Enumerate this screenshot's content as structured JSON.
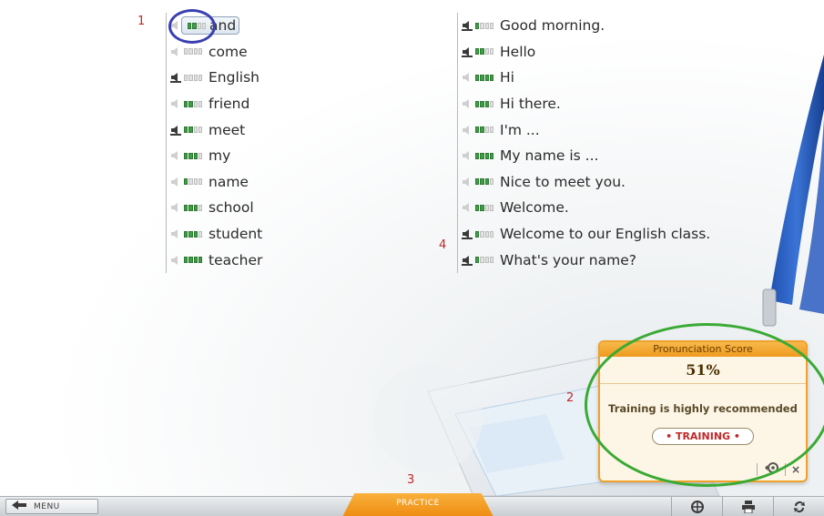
{
  "words": [
    {
      "text": "and",
      "icon": "speaker-icon",
      "recorded": false,
      "level": 2,
      "selected": true
    },
    {
      "text": "come",
      "icon": "speaker-icon",
      "recorded": false,
      "level": 0,
      "selected": false
    },
    {
      "text": "English",
      "icon": "speaker-icon",
      "recorded": true,
      "level": 0,
      "selected": false
    },
    {
      "text": "friend",
      "icon": "speaker-icon",
      "recorded": false,
      "level": 2,
      "selected": false
    },
    {
      "text": "meet",
      "icon": "speaker-icon",
      "recorded": true,
      "level": 2,
      "selected": false
    },
    {
      "text": "my",
      "icon": "speaker-icon",
      "recorded": false,
      "level": 3,
      "selected": false
    },
    {
      "text": "name",
      "icon": "speaker-icon",
      "recorded": false,
      "level": 1,
      "selected": false
    },
    {
      "text": "school",
      "icon": "speaker-icon",
      "recorded": false,
      "level": 3,
      "selected": false
    },
    {
      "text": "student",
      "icon": "speaker-icon",
      "recorded": false,
      "level": 3,
      "selected": false
    },
    {
      "text": "teacher",
      "icon": "speaker-icon",
      "recorded": false,
      "level": 4,
      "selected": false
    }
  ],
  "phrases": [
    {
      "text": "Good morning.",
      "icon": "speaker-icon",
      "recorded": true,
      "level": 1
    },
    {
      "text": "Hello",
      "icon": "speaker-icon",
      "recorded": true,
      "level": 2
    },
    {
      "text": "Hi",
      "icon": "speaker-icon",
      "recorded": false,
      "level": 4
    },
    {
      "text": "Hi there.",
      "icon": "speaker-icon",
      "recorded": false,
      "level": 3
    },
    {
      "text": "I'm ...",
      "icon": "speaker-icon",
      "recorded": false,
      "level": 2
    },
    {
      "text": "My name is ...",
      "icon": "speaker-icon",
      "recorded": false,
      "level": 4
    },
    {
      "text": "Nice to meet you.",
      "icon": "speaker-icon",
      "recorded": false,
      "level": 3
    },
    {
      "text": "Welcome.",
      "icon": "speaker-icon",
      "recorded": false,
      "level": 2
    },
    {
      "text": "Welcome to our English class.",
      "icon": "speaker-icon",
      "recorded": true,
      "level": 1
    },
    {
      "text": "What's your name?",
      "icon": "speaker-icon",
      "recorded": true,
      "level": 1
    }
  ],
  "markers": {
    "m1": "1",
    "m2": "2",
    "m3": "3",
    "m4": "4"
  },
  "score_panel": {
    "title": "Pronunciation Score",
    "score": "51%",
    "message": "Training is highly recommended",
    "training_button": "• TRAINING •",
    "close_label": "×"
  },
  "toolbar": {
    "menu_label": "MENU",
    "practice_label": "PRACTICE"
  },
  "colors": {
    "accent": "#ef8b12",
    "level_on": "#3f9d45",
    "marker": "#c0282a",
    "circle_blue": "#3a3fb0",
    "ellipse_green": "#3aaa35"
  }
}
